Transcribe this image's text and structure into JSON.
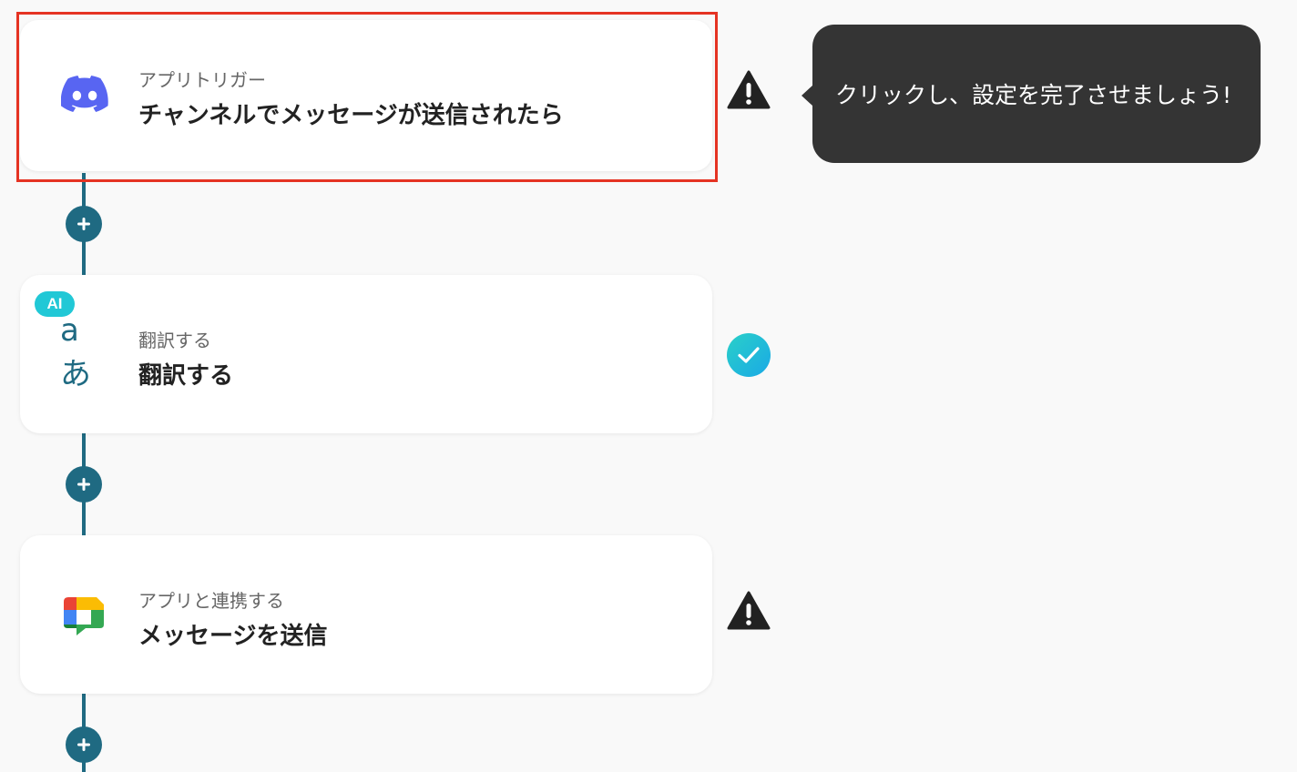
{
  "steps": [
    {
      "subtitle": "アプリトリガー",
      "title": "チャンネルでメッセージが送信されたら",
      "icon": "discord-icon",
      "status": "warning"
    },
    {
      "badge": "AI",
      "subtitle": "翻訳する",
      "title": "翻訳する",
      "icon_text": "aあ",
      "icon": "translate-icon",
      "status": "complete"
    },
    {
      "subtitle": "アプリと連携する",
      "title": "メッセージを送信",
      "icon": "google-chat-icon",
      "status": "warning"
    }
  ],
  "tooltip": {
    "text": "クリックし、設定を完了させましょう!"
  },
  "colors": {
    "connector": "#1f6a82",
    "selection_border": "#e53323",
    "ai_badge": "#21c8d6",
    "discord": "#5865f2",
    "tooltip_bg": "#343434",
    "warning": "#222222"
  }
}
